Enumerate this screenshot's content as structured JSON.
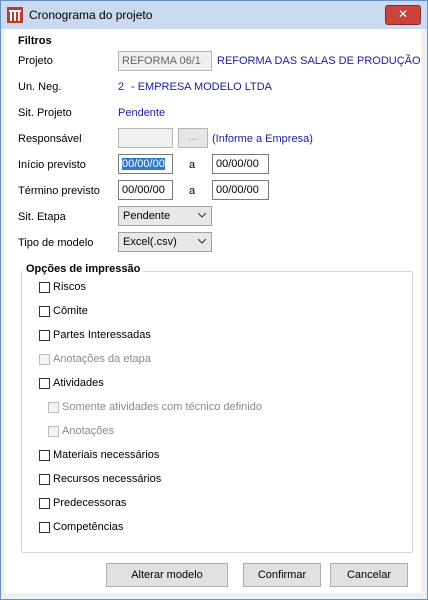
{
  "window": {
    "title": "Cronograma do projeto",
    "close_glyph": "✕"
  },
  "filtros": {
    "title": "Filtros",
    "projeto": {
      "label": "Projeto",
      "code": "REFORMA 06/1",
      "name": "REFORMA DAS SALAS DE PRODUÇÃO"
    },
    "un_neg": {
      "label": "Un. Neg.",
      "code": "2",
      "name": "- EMPRESA MODELO LTDA"
    },
    "sit_projeto": {
      "label": "Sit. Projeto",
      "value": "Pendente"
    },
    "responsavel": {
      "label": "Responsável",
      "value": "",
      "button": "...",
      "hint": "(Informe a Empresa)"
    },
    "inicio": {
      "label": "Início previsto",
      "from": "00/00/00",
      "sep": "a",
      "to": "00/00/00"
    },
    "termino": {
      "label": "Término previsto",
      "from": "00/00/00",
      "sep": "a",
      "to": "00/00/00"
    },
    "sit_etapa": {
      "label": "Sit. Etapa",
      "value": "Pendente"
    },
    "tipo_modelo": {
      "label": "Tipo de modelo",
      "value": "Excel(.csv)"
    }
  },
  "opcoes": {
    "title": "Opções de impressão",
    "items": [
      {
        "label": "Riscos",
        "checked": false,
        "disabled": false
      },
      {
        "label": "Cômite",
        "checked": false,
        "disabled": false
      },
      {
        "label": "Partes Interessadas",
        "checked": false,
        "disabled": false
      },
      {
        "label": "Anotações da etapa",
        "checked": false,
        "disabled": true
      },
      {
        "label": "Atividades",
        "checked": false,
        "disabled": false
      },
      {
        "label": "Somente atividades com técnico definido",
        "checked": false,
        "disabled": true
      },
      {
        "label": "Anotações",
        "checked": false,
        "disabled": true
      },
      {
        "label": "Materiais necessários",
        "checked": false,
        "disabled": false
      },
      {
        "label": "Recursos necessários",
        "checked": false,
        "disabled": false
      },
      {
        "label": "Predecessoras",
        "checked": false,
        "disabled": false
      },
      {
        "label": "Competências",
        "checked": false,
        "disabled": false
      }
    ]
  },
  "buttons": {
    "alterar": "Alterar modelo",
    "confirmar": "Confirmar",
    "cancelar": "Cancelar"
  }
}
